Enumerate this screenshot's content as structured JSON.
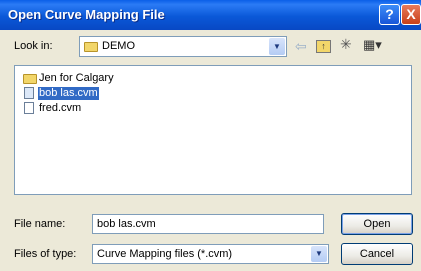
{
  "window": {
    "title": "Open Curve Mapping File",
    "help_glyph": "?",
    "close_glyph": "X"
  },
  "lookin": {
    "label": "Look in:",
    "value": "DEMO",
    "folder_icon": "folder-icon"
  },
  "toolbar": {
    "back_icon": "back-arrow-icon",
    "up_icon": "up-folder-icon",
    "new_folder_icon": "new-folder-icon",
    "views_icon": "views-menu-icon"
  },
  "file_list": {
    "items": [
      {
        "label": "Jen for Calgary",
        "type": "folder",
        "selected": false
      },
      {
        "label": "bob las.cvm",
        "type": "file",
        "selected": true
      },
      {
        "label": "fred.cvm",
        "type": "file",
        "selected": false
      }
    ]
  },
  "filename": {
    "label": "File name:",
    "value": "bob las.cvm"
  },
  "filetype": {
    "label": "Files of type:",
    "value": "Curve Mapping files (*.cvm)"
  },
  "buttons": {
    "open": "Open",
    "cancel": "Cancel"
  },
  "colors": {
    "titlebar": "#0A58D8",
    "dialog_bg": "#ECE9D8",
    "selection": "#316AC5"
  }
}
